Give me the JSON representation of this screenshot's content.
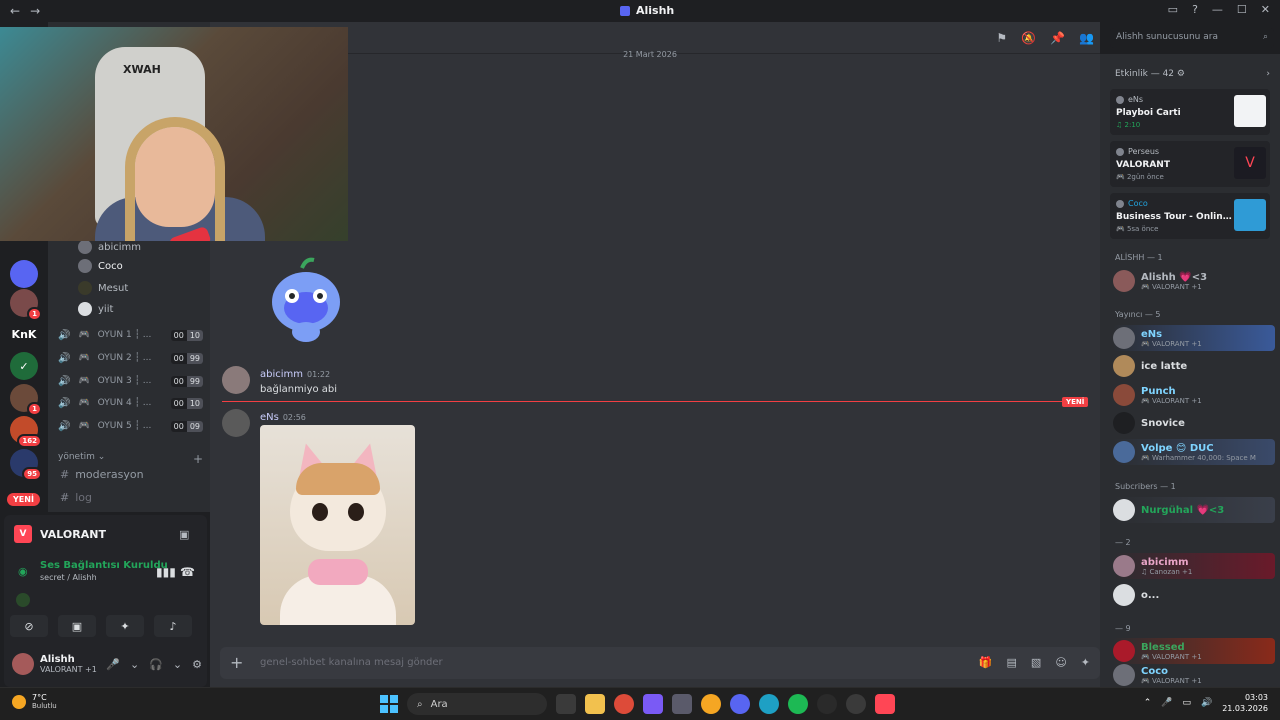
{
  "titlebar": {
    "title": "Alishh",
    "back": "←",
    "forward": "→"
  },
  "rail": {
    "servers": [
      {
        "label": "",
        "badge": ""
      },
      {
        "label": "",
        "badge": ""
      },
      {
        "label": "",
        "badge": "1"
      },
      {
        "label": "KnK",
        "badge": ""
      },
      {
        "label": "",
        "badge": ""
      },
      {
        "label": "",
        "badge": "1"
      },
      {
        "label": "",
        "badge": "162"
      },
      {
        "label": "",
        "badge": "95"
      }
    ],
    "new_pill": "YENİ"
  },
  "channels": {
    "voice_members": [
      "abicimm",
      "Coco",
      "Mesut",
      "yiit"
    ],
    "voice_channels": [
      {
        "name": "OYUN 1 ┆ ...",
        "a": "00",
        "b": "10"
      },
      {
        "name": "OYUN 2 ┆ ...",
        "a": "00",
        "b": "99"
      },
      {
        "name": "OYUN 3 ┆ ...",
        "a": "00",
        "b": "99"
      },
      {
        "name": "OYUN 4 ┆ ...",
        "a": "00",
        "b": "10"
      },
      {
        "name": "OYUN 5 ┆ ...",
        "a": "00",
        "b": "09"
      }
    ],
    "category": "yönetim",
    "text_channels": [
      "moderasyon",
      "log"
    ]
  },
  "voice_panel": {
    "game": "VALORANT",
    "connected": "Ses Bağlantısı Kuruldu",
    "location": "secret  / Alishh"
  },
  "user": {
    "name": "Alishh",
    "status": "VALORANT +1"
  },
  "webcam": {
    "chair_brand": "XWAH"
  },
  "chat": {
    "date": "21 Mart 2026",
    "new_label": "YENİ",
    "messages": [
      {
        "author": "abicimm",
        "time": "01:22",
        "text": "bağlanmiyo abi"
      },
      {
        "author": "eNs",
        "time": "02:56",
        "text": ""
      }
    ],
    "composer_placeholder": "genel-sohbet kanalına mesaj gönder"
  },
  "search": {
    "placeholder": "Alishh sunucusunu ara"
  },
  "activity": {
    "header": "Etkinlik — 42",
    "items": [
      {
        "who": "eNs",
        "what": "Playboi Carti",
        "meta": "♫ 2:10",
        "who_color": "#b5bac1",
        "meta_color": "#23a55a",
        "thumb": "#f2f3f5"
      },
      {
        "who": "Perseus",
        "what": "VALORANT",
        "meta": "🎮 2gün önce",
        "who_color": "#b5bac1",
        "meta_color": "#949ba4",
        "thumb": "#1b1b22"
      },
      {
        "who": "Coco",
        "what": "Business Tour - Online Mul...",
        "meta": "🎮 5sa önce",
        "who_color": "#23a5e0",
        "meta_color": "#949ba4",
        "thumb": "#2f9bd6"
      }
    ]
  },
  "members": {
    "sections": [
      {
        "title": "ALİSHH — 1"
      },
      {
        "title": "Yayıncı — 5"
      },
      {
        "title": "Subcribers — 1"
      },
      {
        "title": "— 2"
      },
      {
        "title": "— 9"
      }
    ],
    "list": [
      {
        "name": "Alishh 💗<3",
        "sub": "🎮 VALORANT +1",
        "color": "#b5bac1"
      },
      {
        "name": "eNs",
        "sub": "🎮 VALORANT +1",
        "color": "#7fd4ff"
      },
      {
        "name": "ice latte",
        "sub": "",
        "color": "#dbdee1"
      },
      {
        "name": "Punch",
        "sub": "🎮 VALORANT +1",
        "color": "#7fd4ff"
      },
      {
        "name": "Snovice",
        "sub": "",
        "color": "#dbdee1"
      },
      {
        "name": "Volpe 😊 DUC",
        "sub": "🎮 Warhammer 40,000: Space M",
        "color": "#7fd4ff"
      },
      {
        "name": "Nurgühal 💗<3",
        "sub": "",
        "color": "#23a55a"
      },
      {
        "name": "abicimm",
        "sub": "♫ Canozan +1",
        "color": "#e9a5c8"
      },
      {
        "name": "o...",
        "sub": "",
        "color": "#dbdee1"
      },
      {
        "name": "Blessed",
        "sub": "🎮 VALORANT +1",
        "color": "#3ba55d"
      },
      {
        "name": "Coco",
        "sub": "🎮 VALORANT +1",
        "color": "#7fd4ff"
      }
    ]
  },
  "taskbar": {
    "temp": "7°C",
    "weather": "Bulutlu",
    "search": "Ara",
    "time": "03:03",
    "date": "21.03.2026"
  },
  "colors": {
    "accent": "#5865f2",
    "danger": "#f23f43",
    "online": "#23a55a"
  }
}
